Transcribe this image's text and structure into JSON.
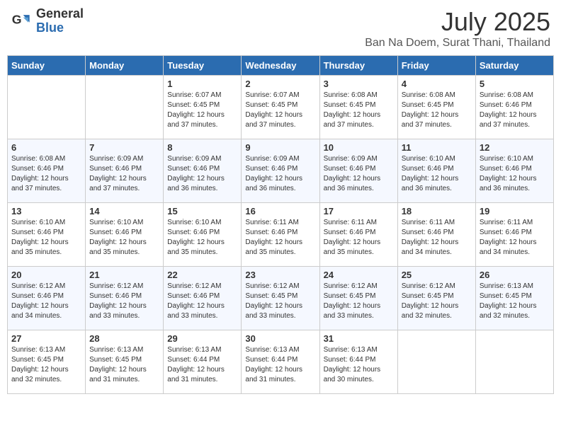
{
  "header": {
    "logo_general": "General",
    "logo_blue": "Blue",
    "month": "July 2025",
    "location": "Ban Na Doem, Surat Thani, Thailand"
  },
  "days_of_week": [
    "Sunday",
    "Monday",
    "Tuesday",
    "Wednesday",
    "Thursday",
    "Friday",
    "Saturday"
  ],
  "weeks": [
    [
      {
        "day": "",
        "sunrise": "",
        "sunset": "",
        "daylight": ""
      },
      {
        "day": "",
        "sunrise": "",
        "sunset": "",
        "daylight": ""
      },
      {
        "day": "1",
        "sunrise": "Sunrise: 6:07 AM",
        "sunset": "Sunset: 6:45 PM",
        "daylight": "Daylight: 12 hours and 37 minutes."
      },
      {
        "day": "2",
        "sunrise": "Sunrise: 6:07 AM",
        "sunset": "Sunset: 6:45 PM",
        "daylight": "Daylight: 12 hours and 37 minutes."
      },
      {
        "day": "3",
        "sunrise": "Sunrise: 6:08 AM",
        "sunset": "Sunset: 6:45 PM",
        "daylight": "Daylight: 12 hours and 37 minutes."
      },
      {
        "day": "4",
        "sunrise": "Sunrise: 6:08 AM",
        "sunset": "Sunset: 6:45 PM",
        "daylight": "Daylight: 12 hours and 37 minutes."
      },
      {
        "day": "5",
        "sunrise": "Sunrise: 6:08 AM",
        "sunset": "Sunset: 6:46 PM",
        "daylight": "Daylight: 12 hours and 37 minutes."
      }
    ],
    [
      {
        "day": "6",
        "sunrise": "Sunrise: 6:08 AM",
        "sunset": "Sunset: 6:46 PM",
        "daylight": "Daylight: 12 hours and 37 minutes."
      },
      {
        "day": "7",
        "sunrise": "Sunrise: 6:09 AM",
        "sunset": "Sunset: 6:46 PM",
        "daylight": "Daylight: 12 hours and 37 minutes."
      },
      {
        "day": "8",
        "sunrise": "Sunrise: 6:09 AM",
        "sunset": "Sunset: 6:46 PM",
        "daylight": "Daylight: 12 hours and 36 minutes."
      },
      {
        "day": "9",
        "sunrise": "Sunrise: 6:09 AM",
        "sunset": "Sunset: 6:46 PM",
        "daylight": "Daylight: 12 hours and 36 minutes."
      },
      {
        "day": "10",
        "sunrise": "Sunrise: 6:09 AM",
        "sunset": "Sunset: 6:46 PM",
        "daylight": "Daylight: 12 hours and 36 minutes."
      },
      {
        "day": "11",
        "sunrise": "Sunrise: 6:10 AM",
        "sunset": "Sunset: 6:46 PM",
        "daylight": "Daylight: 12 hours and 36 minutes."
      },
      {
        "day": "12",
        "sunrise": "Sunrise: 6:10 AM",
        "sunset": "Sunset: 6:46 PM",
        "daylight": "Daylight: 12 hours and 36 minutes."
      }
    ],
    [
      {
        "day": "13",
        "sunrise": "Sunrise: 6:10 AM",
        "sunset": "Sunset: 6:46 PM",
        "daylight": "Daylight: 12 hours and 35 minutes."
      },
      {
        "day": "14",
        "sunrise": "Sunrise: 6:10 AM",
        "sunset": "Sunset: 6:46 PM",
        "daylight": "Daylight: 12 hours and 35 minutes."
      },
      {
        "day": "15",
        "sunrise": "Sunrise: 6:10 AM",
        "sunset": "Sunset: 6:46 PM",
        "daylight": "Daylight: 12 hours and 35 minutes."
      },
      {
        "day": "16",
        "sunrise": "Sunrise: 6:11 AM",
        "sunset": "Sunset: 6:46 PM",
        "daylight": "Daylight: 12 hours and 35 minutes."
      },
      {
        "day": "17",
        "sunrise": "Sunrise: 6:11 AM",
        "sunset": "Sunset: 6:46 PM",
        "daylight": "Daylight: 12 hours and 35 minutes."
      },
      {
        "day": "18",
        "sunrise": "Sunrise: 6:11 AM",
        "sunset": "Sunset: 6:46 PM",
        "daylight": "Daylight: 12 hours and 34 minutes."
      },
      {
        "day": "19",
        "sunrise": "Sunrise: 6:11 AM",
        "sunset": "Sunset: 6:46 PM",
        "daylight": "Daylight: 12 hours and 34 minutes."
      }
    ],
    [
      {
        "day": "20",
        "sunrise": "Sunrise: 6:12 AM",
        "sunset": "Sunset: 6:46 PM",
        "daylight": "Daylight: 12 hours and 34 minutes."
      },
      {
        "day": "21",
        "sunrise": "Sunrise: 6:12 AM",
        "sunset": "Sunset: 6:46 PM",
        "daylight": "Daylight: 12 hours and 33 minutes."
      },
      {
        "day": "22",
        "sunrise": "Sunrise: 6:12 AM",
        "sunset": "Sunset: 6:46 PM",
        "daylight": "Daylight: 12 hours and 33 minutes."
      },
      {
        "day": "23",
        "sunrise": "Sunrise: 6:12 AM",
        "sunset": "Sunset: 6:45 PM",
        "daylight": "Daylight: 12 hours and 33 minutes."
      },
      {
        "day": "24",
        "sunrise": "Sunrise: 6:12 AM",
        "sunset": "Sunset: 6:45 PM",
        "daylight": "Daylight: 12 hours and 33 minutes."
      },
      {
        "day": "25",
        "sunrise": "Sunrise: 6:12 AM",
        "sunset": "Sunset: 6:45 PM",
        "daylight": "Daylight: 12 hours and 32 minutes."
      },
      {
        "day": "26",
        "sunrise": "Sunrise: 6:13 AM",
        "sunset": "Sunset: 6:45 PM",
        "daylight": "Daylight: 12 hours and 32 minutes."
      }
    ],
    [
      {
        "day": "27",
        "sunrise": "Sunrise: 6:13 AM",
        "sunset": "Sunset: 6:45 PM",
        "daylight": "Daylight: 12 hours and 32 minutes."
      },
      {
        "day": "28",
        "sunrise": "Sunrise: 6:13 AM",
        "sunset": "Sunset: 6:45 PM",
        "daylight": "Daylight: 12 hours and 31 minutes."
      },
      {
        "day": "29",
        "sunrise": "Sunrise: 6:13 AM",
        "sunset": "Sunset: 6:44 PM",
        "daylight": "Daylight: 12 hours and 31 minutes."
      },
      {
        "day": "30",
        "sunrise": "Sunrise: 6:13 AM",
        "sunset": "Sunset: 6:44 PM",
        "daylight": "Daylight: 12 hours and 31 minutes."
      },
      {
        "day": "31",
        "sunrise": "Sunrise: 6:13 AM",
        "sunset": "Sunset: 6:44 PM",
        "daylight": "Daylight: 12 hours and 30 minutes."
      },
      {
        "day": "",
        "sunrise": "",
        "sunset": "",
        "daylight": ""
      },
      {
        "day": "",
        "sunrise": "",
        "sunset": "",
        "daylight": ""
      }
    ]
  ]
}
